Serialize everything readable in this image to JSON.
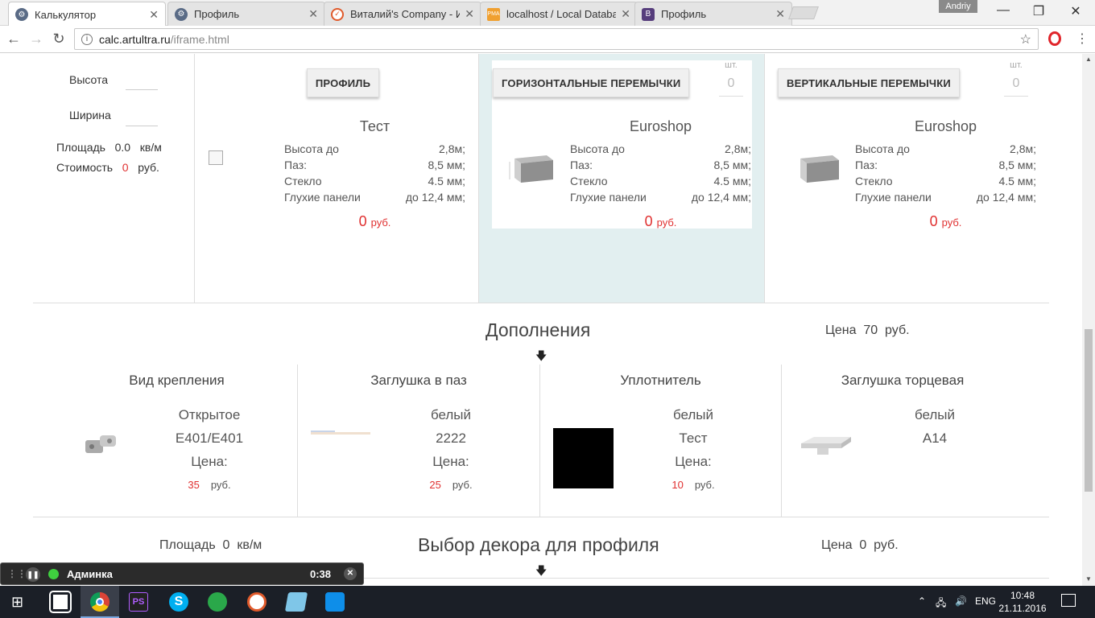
{
  "browser": {
    "tabs": [
      {
        "title": "Калькулятор",
        "active": true
      },
      {
        "title": "Профиль"
      },
      {
        "title": "Виталий's Company - Из"
      },
      {
        "title": "localhost / Local Databa"
      },
      {
        "title": "Профиль"
      }
    ],
    "user": "Andriy",
    "url_host": "calc.artultra.ru",
    "url_path": "/iframe.html"
  },
  "left": {
    "height_label": "Высота",
    "width_label": "Ширина",
    "area_label": "Площадь",
    "area_value": "0.0",
    "area_unit": "кв/м",
    "cost_label": "Стоимость",
    "cost_value": "0",
    "cost_unit": "руб."
  },
  "products": [
    {
      "button": "ПРОФИЛЬ",
      "brand": "Тест",
      "specs": [
        [
          "Высота до",
          "2,8м;"
        ],
        [
          "Паз:",
          "8,5 мм;"
        ],
        [
          "Стекло",
          "4.5 мм;"
        ],
        [
          "Глухие панели",
          "до 12,4 мм;"
        ]
      ],
      "price": "0",
      "currency": "руб."
    },
    {
      "button": "ГОРИЗОНТАЛЬНЫЕ ПЕРЕМЫЧКИ",
      "qty_label": "шт.",
      "qty": "0",
      "brand": "Euroshop",
      "specs": [
        [
          "Высота до",
          "2,8м;"
        ],
        [
          "Паз:",
          "8,5 мм;"
        ],
        [
          "Стекло",
          "4.5 мм;"
        ],
        [
          "Глухие панели",
          "до 12,4 мм;"
        ]
      ],
      "price": "0",
      "currency": "руб."
    },
    {
      "button": "ВЕРТИКАЛЬНЫЕ ПЕРЕМЫЧКИ",
      "qty_label": "шт.",
      "qty": "0",
      "brand": "Euroshop",
      "specs": [
        [
          "Высота до",
          "2,8м;"
        ],
        [
          "Паз:",
          "8,5 мм;"
        ],
        [
          "Стекло",
          "4.5 мм;"
        ],
        [
          "Глухие панели",
          "до 12,4 мм;"
        ]
      ],
      "price": "0",
      "currency": "руб."
    }
  ],
  "addons": {
    "title": "Дополнения",
    "price_label": "Цена",
    "price_value": "70",
    "price_unit": "руб.",
    "items": [
      {
        "head": "Вид крепления",
        "l1": "Открытое",
        "l2": "E401/E401",
        "l3": "Цена:",
        "price": "35",
        "unit": "руб."
      },
      {
        "head": "Заглушка в паз",
        "l1": "белый",
        "l2": "2222",
        "l3": "Цена:",
        "price": "25",
        "unit": "руб."
      },
      {
        "head": "Уплотнитель",
        "l1": "белый",
        "l2": "Тест",
        "l3": "Цена:",
        "price": "10",
        "unit": "руб."
      },
      {
        "head": "Заглушка торцевая",
        "l1": "белый",
        "l2": "A14"
      }
    ]
  },
  "decor": {
    "area_label": "Площадь",
    "area_value": "0",
    "area_unit": "кв/м",
    "title": "Выбор декора для профиля",
    "price_label": "Цена",
    "price_value": "0",
    "price_unit": "руб."
  },
  "recorder": {
    "title": "Админка",
    "time": "0:38"
  },
  "taskbar": {
    "lang": "ENG",
    "time": "10:48",
    "date": "21.11.2016"
  }
}
